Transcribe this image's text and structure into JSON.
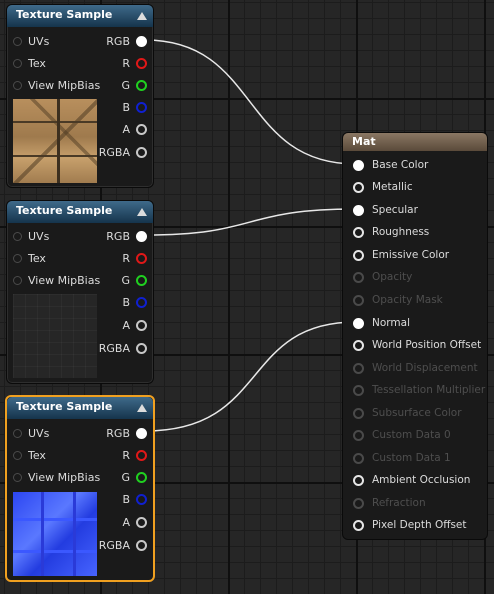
{
  "nodes": [
    {
      "title": "Texture Sample",
      "selected": false,
      "thumbnail": "wood-texture-thumbnail",
      "inputs": [
        "UVs",
        "Tex",
        "View MipBias"
      ],
      "outputs": [
        "RGB",
        "R",
        "G",
        "B",
        "A",
        "RGBA"
      ]
    },
    {
      "title": "Texture Sample",
      "selected": false,
      "thumbnail": "dark-texture-thumbnail",
      "inputs": [
        "UVs",
        "Tex",
        "View MipBias"
      ],
      "outputs": [
        "RGB",
        "R",
        "G",
        "B",
        "A",
        "RGBA"
      ]
    },
    {
      "title": "Texture Sample",
      "selected": true,
      "thumbnail": "normal-map-thumbnail",
      "inputs": [
        "UVs",
        "Tex",
        "View MipBias"
      ],
      "outputs": [
        "RGB",
        "R",
        "G",
        "B",
        "A",
        "RGBA"
      ]
    }
  ],
  "material": {
    "title": "Mat",
    "inputs": [
      {
        "label": "Base Color",
        "enabled": true,
        "connected": true
      },
      {
        "label": "Metallic",
        "enabled": true,
        "connected": false
      },
      {
        "label": "Specular",
        "enabled": true,
        "connected": true
      },
      {
        "label": "Roughness",
        "enabled": true,
        "connected": false
      },
      {
        "label": "Emissive Color",
        "enabled": true,
        "connected": false
      },
      {
        "label": "Opacity",
        "enabled": false,
        "connected": false
      },
      {
        "label": "Opacity Mask",
        "enabled": false,
        "connected": false
      },
      {
        "label": "Normal",
        "enabled": true,
        "connected": true
      },
      {
        "label": "World Position Offset",
        "enabled": true,
        "connected": false
      },
      {
        "label": "World Displacement",
        "enabled": false,
        "connected": false
      },
      {
        "label": "Tessellation Multiplier",
        "enabled": false,
        "connected": false
      },
      {
        "label": "Subsurface Color",
        "enabled": false,
        "connected": false
      },
      {
        "label": "Custom Data 0",
        "enabled": false,
        "connected": false
      },
      {
        "label": "Custom Data 1",
        "enabled": false,
        "connected": false
      },
      {
        "label": "Ambient Occlusion",
        "enabled": true,
        "connected": false
      },
      {
        "label": "Refraction",
        "enabled": false,
        "connected": false
      },
      {
        "label": "Pixel Depth Offset",
        "enabled": true,
        "connected": false
      }
    ]
  },
  "connections": [
    {
      "from_node": 0,
      "from_pin": "RGB",
      "to_input": "Base Color"
    },
    {
      "from_node": 1,
      "from_pin": "RGB",
      "to_input": "Specular"
    },
    {
      "from_node": 2,
      "from_pin": "RGB",
      "to_input": "Normal"
    }
  ],
  "colors": {
    "wire": "#e8e8e8",
    "selection": "#f0a020",
    "pin_r": "#e01818",
    "pin_g": "#20d020",
    "pin_b": "#1020d0"
  },
  "icons": {
    "collapse": "collapse-arrow-icon"
  }
}
